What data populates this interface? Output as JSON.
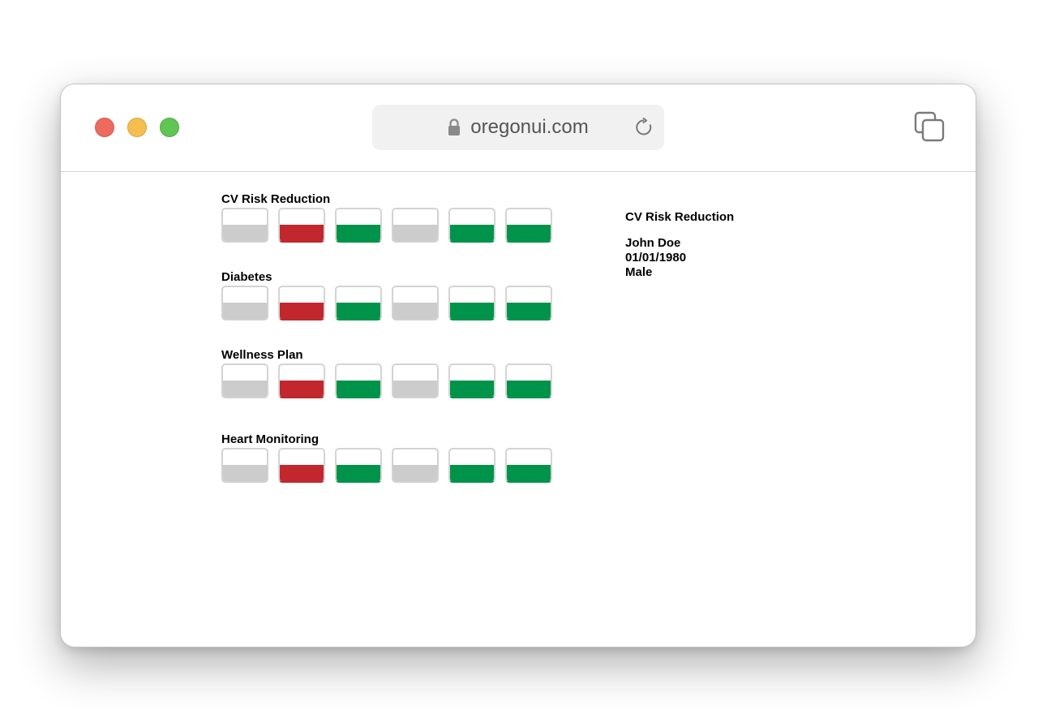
{
  "browser": {
    "url": "oregonui.com",
    "icons": {
      "lock": "lock-icon",
      "reload": "reload-icon",
      "tabs": "tabs-overview-icon"
    },
    "traffic_lights": {
      "close": "#ed6a5e",
      "minimize": "#f5bf4f",
      "zoom": "#61c554"
    }
  },
  "colors": {
    "grey": "#cccccc",
    "red": "#c1272d",
    "green": "#00934a"
  },
  "groups": [
    {
      "title": "CV Risk Reduction",
      "cells": [
        "grey",
        "red",
        "green",
        "grey",
        "green",
        "green"
      ]
    },
    {
      "title": "Diabetes",
      "cells": [
        "grey",
        "red",
        "green",
        "grey",
        "green",
        "green"
      ]
    },
    {
      "title": "Wellness Plan",
      "cells": [
        "grey",
        "red",
        "green",
        "grey",
        "green",
        "green"
      ]
    },
    {
      "title": "Heart Monitoring",
      "cells": [
        "grey",
        "red",
        "green",
        "grey",
        "green",
        "green"
      ]
    }
  ],
  "info_panel": {
    "title": "CV Risk Reduction",
    "patient_name": "John Doe",
    "dob": "01/01/1980",
    "sex": "Male"
  }
}
